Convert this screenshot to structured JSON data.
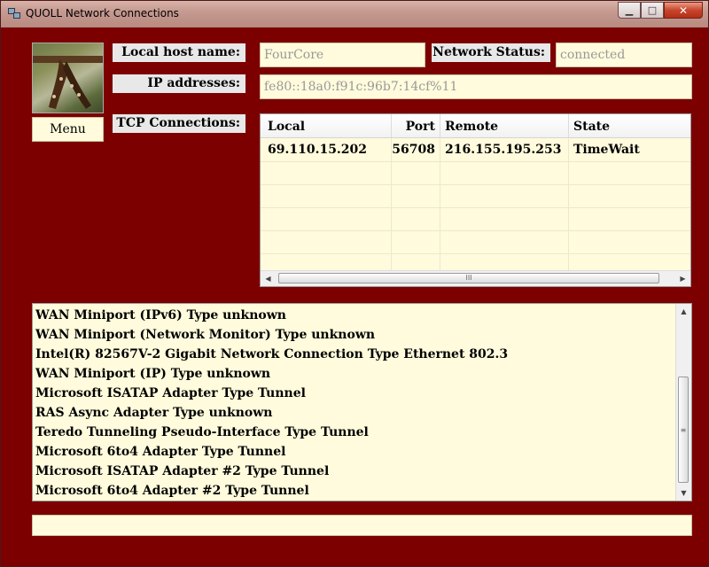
{
  "window": {
    "title": "QUOLL Network Connections",
    "minimize": "▁",
    "maximize": "□",
    "close": "✕"
  },
  "menu_label": "Menu",
  "labels": {
    "local_host": "Local host name:",
    "network_status": "Network Status:",
    "ip_addresses": "IP addresses:",
    "tcp_connections": "TCP Connections:"
  },
  "fields": {
    "local_host": "FourCore",
    "network_status": "connected",
    "ip_addresses": "fe80::18a0:f91c:96b7:14cf%11"
  },
  "tcp_table": {
    "columns": [
      "Local",
      "Port",
      "Remote",
      "State"
    ],
    "rows": [
      {
        "local": "69.110.15.202",
        "port": "56708",
        "remote": "216.155.195.253",
        "state": "TimeWait"
      }
    ]
  },
  "adapters": [
    "WAN Miniport (IPv6) Type unknown",
    "WAN Miniport (Network Monitor) Type unknown",
    "Intel(R) 82567V-2 Gigabit Network Connection Type Ethernet 802.3",
    "WAN Miniport (IP) Type unknown",
    "Microsoft ISATAP Adapter Type Tunnel",
    "RAS Async Adapter Type unknown",
    "Teredo Tunneling Pseudo-Interface Type Tunnel",
    "Microsoft 6to4 Adapter Type Tunnel",
    "Microsoft ISATAP Adapter #2 Type Tunnel",
    "Microsoft 6to4 Adapter #2 Type Tunnel"
  ],
  "scroll": {
    "h_grip": "III",
    "v_grip": "≡",
    "left": "◀",
    "right": "▶",
    "up": "▲",
    "down": "▼"
  },
  "status_text": ""
}
